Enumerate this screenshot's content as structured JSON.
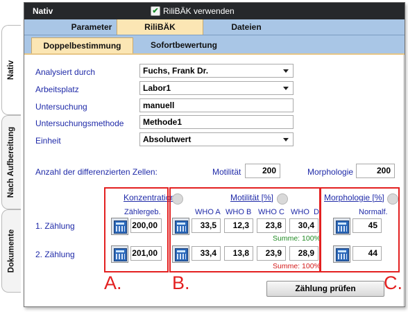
{
  "side_tabs": [
    "Nativ",
    "Nach Aufbereitung",
    "Dokumente"
  ],
  "window": {
    "title": "Nativ",
    "checkbox_label": "RiliBÄK verwenden",
    "checkbox_checked": true
  },
  "tabs": [
    "Parameter",
    "RiliBÄK",
    "Dateien"
  ],
  "subtabs": [
    "Doppelbestimmung",
    "Sofortbewertung"
  ],
  "form": {
    "analysiert_label": "Analysiert durch",
    "analysiert_value": "Fuchs, Frank Dr.",
    "arbeitsplatz_label": "Arbeitsplatz",
    "arbeitsplatz_value": "Labor1",
    "untersuchung_label": "Untersuchung",
    "untersuchung_value": "manuell",
    "methode_label": "Untersuchungsmethode",
    "methode_value": "Methode1",
    "einheit_label": "Einheit",
    "einheit_value": "Absolutwert"
  },
  "cells": {
    "label": "Anzahl der differenzierten Zellen:",
    "motilitaet_label": "Motilität",
    "motilitaet_value": "200",
    "morphologie_label": "Morphologie",
    "morphologie_value": "200"
  },
  "sections": {
    "konzentration": {
      "title": "Konzentration",
      "col": "Zählergeb.",
      "row1": "200,00",
      "row2": "201,00"
    },
    "motilitaet": {
      "title": "Motilität [%]",
      "cols": [
        "WHO A",
        "WHO B",
        "WHO C",
        "WHO  D"
      ],
      "row1": [
        "33,5",
        "12,3",
        "23,8",
        "30,4"
      ],
      "row2": [
        "33,4",
        "13,8",
        "23,9",
        "28,9"
      ],
      "summe1": "Summe: 100%",
      "summe2": "Summe: 100%"
    },
    "morphologie": {
      "title": "Morphologie [%]",
      "col": "Normalf.",
      "row1": "45",
      "row2": "44"
    }
  },
  "rows": {
    "row1_label": "1. Zählung",
    "row2_label": "2. Zählung"
  },
  "button": {
    "label": "Zählung prüfen"
  },
  "annotations": [
    "A.",
    "B.",
    "C."
  ],
  "colors": {
    "annotation_red": "#e32020",
    "active_tab": "#fbe6b4",
    "tab_bar": "#a9c6e6",
    "label_blue": "#1f2aa8",
    "sum_ok": "#1e8a22",
    "sum_bad": "#d41818"
  }
}
